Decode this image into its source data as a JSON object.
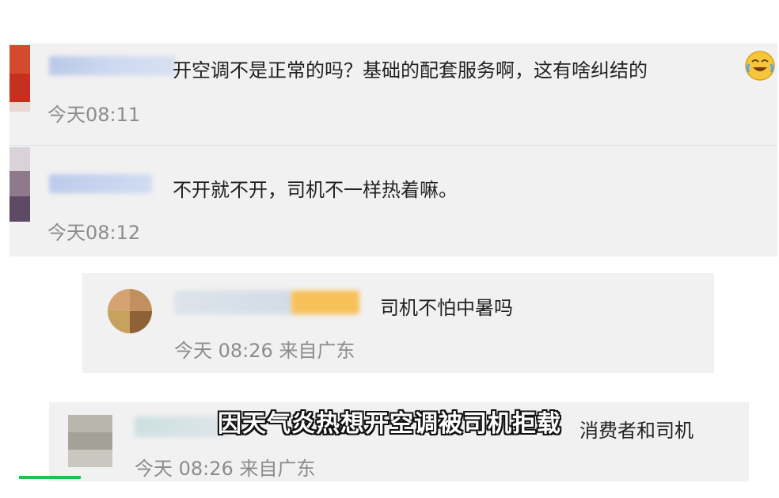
{
  "comments": [
    {
      "text": "开空调不是正常的吗？基础的配套服务啊，这有啥纠结的",
      "time": "今天08:11",
      "emoji": "crying-laughing-emoji"
    },
    {
      "text": "不开就不开，司机不一样热着嘛。",
      "time": "今天08:12"
    }
  ],
  "replies": [
    {
      "text": "司机不怕中暑吗",
      "time": "今天 08:26 来自广东"
    },
    {
      "text_partial": "消费者和司机",
      "time": "今天 08:26 来自广东"
    }
  ],
  "subtitle": "因天气炎热想开空调被司机拒载",
  "colors": {
    "card_bg": "#f1f1f1",
    "time_gray": "#8c8c8c",
    "accent_green": "#27c04d"
  }
}
